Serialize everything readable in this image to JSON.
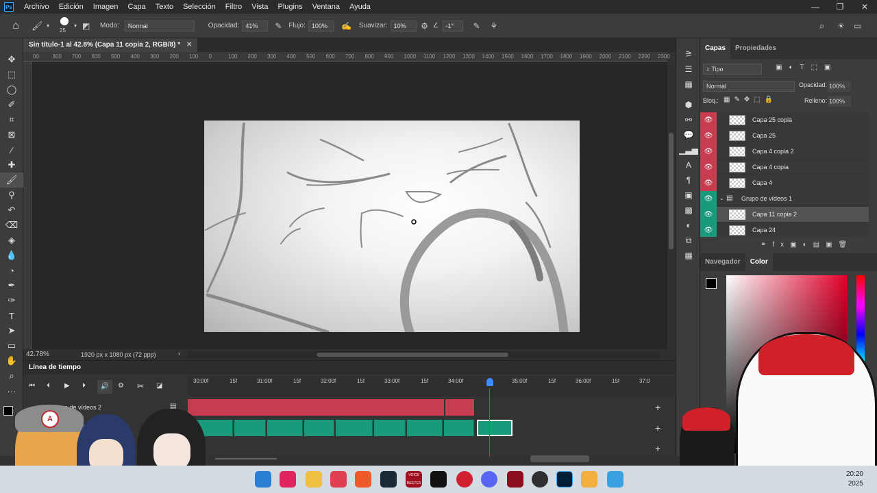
{
  "menubar": {
    "logo": "Ps",
    "items": [
      "Archivo",
      "Edición",
      "Imagen",
      "Capa",
      "Texto",
      "Selección",
      "Filtro",
      "Vista",
      "Plugins",
      "Ventana",
      "Ayuda"
    ]
  },
  "options": {
    "brush_size": "25",
    "mode_label": "Modo:",
    "mode_value": "Normal",
    "opacity_label": "Opacidad:",
    "opacity_value": "41%",
    "flow_label": "Flujo:",
    "flow_value": "100%",
    "smooth_label": "Suavizar:",
    "smooth_value": "10%",
    "angle_value": "-1°"
  },
  "document": {
    "tab_title": "Sin título-1 al 42.8% (Capa 11 copia 2, RGB/8) *",
    "ruler_ticks": [
      "00",
      "800",
      "700",
      "600",
      "500",
      "400",
      "300",
      "200",
      "100",
      "0",
      "100",
      "200",
      "300",
      "400",
      "500",
      "600",
      "700",
      "800",
      "900",
      "1000",
      "1100",
      "1200",
      "1300",
      "1400",
      "1500",
      "1600",
      "1700",
      "1800",
      "1900",
      "2000",
      "2100",
      "2200",
      "2300"
    ],
    "zoom": "42.78%",
    "dimensions": "1920 px x 1080 px (72 ppp)"
  },
  "timeline": {
    "title": "Línea de tiempo",
    "time_labels": [
      "30:00f",
      "15f",
      "31:00f",
      "15f",
      "32:00f",
      "15f",
      "33:00f",
      "15f",
      "34:00f",
      "",
      "35:00f",
      "15f",
      "36:00f",
      "15f",
      "37:0"
    ],
    "track_name": "Grupo de vídeos 2"
  },
  "layers_panel": {
    "tabs": [
      "Capas",
      "Propiedades"
    ],
    "filter_label": "Tipo",
    "blend_mode": "Normal",
    "opacity_label": "Opacidad:",
    "opacity_value": "100%",
    "lock_label": "Bloq.:",
    "fill_label": "Relleno:",
    "fill_value": "100%",
    "layers": [
      {
        "name": "Capa 25 copia",
        "color": "#c63d50"
      },
      {
        "name": "Capa 25",
        "color": "#c63d50"
      },
      {
        "name": "Capa 4 copia 2",
        "color": "#c63d50"
      },
      {
        "name": "Capa 4 copia",
        "color": "#c63d50"
      },
      {
        "name": "Capa 4",
        "color": "#c63d50"
      },
      {
        "name": "Grupo de vídeos 1",
        "color": "#1a9a7c"
      },
      {
        "name": "Capa 11 copia 2",
        "color": "#1a9a7c"
      },
      {
        "name": "Capa 24",
        "color": "#1a9a7c"
      }
    ]
  },
  "color_panel": {
    "tabs": [
      "Navegador",
      "Color"
    ]
  },
  "taskbar": {
    "time": "20:20",
    "date": "2025",
    "voice_label": "VOICE MEETER"
  },
  "colors": {
    "red_track": "#c63d50",
    "green_track": "#1a9a7c",
    "playhead": "#3d8bff"
  }
}
